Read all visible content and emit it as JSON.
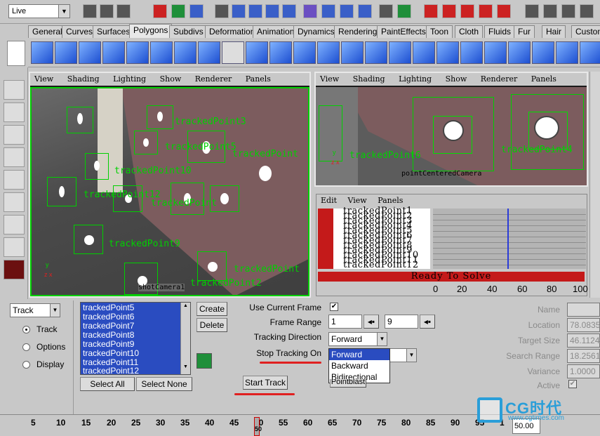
{
  "status_line": {
    "mode_value": "Live"
  },
  "shelf_tabs": [
    "General",
    "Curves",
    "Surfaces",
    "Polygons",
    "Subdivs",
    "Deformation",
    "Animation",
    "Dynamics",
    "Rendering",
    "PaintEffects",
    "Toon",
    "Cloth",
    "Fluids",
    "Fur",
    "Hair",
    "Custom"
  ],
  "active_shelf_tab": "Polygons",
  "viewport_menu": [
    "View",
    "Shading",
    "Lighting",
    "Show",
    "Renderer",
    "Panels"
  ],
  "viewport_left": {
    "camera_label": "shotCamera1",
    "track_labels": [
      "trackedPoint3",
      "trackedPoint5",
      "trackedPoint",
      "trackedPoint10",
      "trackedPoint12",
      "trackedPoint",
      "trackedPoint9",
      "trackedPoint",
      "trackedPoint2"
    ]
  },
  "viewport_right": {
    "camera_label": "pointCenteredCamera",
    "track_labels": [
      "trackedPoint6",
      "trackedPoint4"
    ]
  },
  "graph_editor": {
    "menu": [
      "Edit",
      "View",
      "Panels"
    ],
    "item_names": [
      "trackedPoint1",
      "trackedPoint2",
      "trackedPoint3",
      "trackedPoint4",
      "trackedPoint5",
      "trackedPoint6",
      "trackedPoint7",
      "trackedPoint8",
      "trackedPoint9",
      "trackedPoint10",
      "trackedPoint11",
      "trackedPoint12"
    ],
    "status_text": "Ready To Solve",
    "ticks": [
      "0",
      "20",
      "40",
      "60",
      "80",
      "100"
    ]
  },
  "tracker_panel": {
    "mode_value": "Track",
    "radio_options": [
      "Track",
      "Options",
      "Display"
    ],
    "selected_radio": "Track",
    "points_list": [
      "trackedPoint5",
      "trackedPoint6",
      "trackedPoint7",
      "trackedPoint8",
      "trackedPoint9",
      "trackedPoint10",
      "trackedPoint11",
      "trackedPoint12"
    ],
    "select_all_label": "Select All",
    "select_none_label": "Select None",
    "create_label": "Create",
    "delete_label": "Delete",
    "use_current_frame_label": "Use Current Frame",
    "use_current_frame_checked": true,
    "frame_range_label": "Frame Range",
    "frame_range_start": "1",
    "frame_range_end": "9",
    "tracking_direction_label": "Tracking Direction",
    "tracking_direction_value": "Forward",
    "stop_tracking_on_label": "Stop Tracking On",
    "direction_options": [
      "Forward",
      "Backward",
      "Bidirectional"
    ],
    "direction_highlighted": "Forward",
    "start_track_label": "Start Track",
    "pointblast_label": "Pointblast",
    "name_label": "Name",
    "name_value": "",
    "location_label": "Location",
    "location_value": "78.0835",
    "target_size_label": "Target Size",
    "target_size_value": "46.1124",
    "search_range_label": "Search Range",
    "search_range_value": "18.2561",
    "variance_label": "Variance",
    "variance_value": "1.0000",
    "active_label": "Active",
    "active_checked": true,
    "highlight_color": "#e02020"
  },
  "time_slider": {
    "ticks": [
      "5",
      "10",
      "15",
      "20",
      "25",
      "30",
      "35",
      "40",
      "45",
      "50",
      "55",
      "60",
      "65",
      "70",
      "75",
      "80",
      "85",
      "90",
      "95",
      "1"
    ],
    "current_frame": "50",
    "current_time_field": "50.00"
  },
  "watermark": {
    "brand": "CG时代",
    "url": "www.cgtimes.com"
  }
}
